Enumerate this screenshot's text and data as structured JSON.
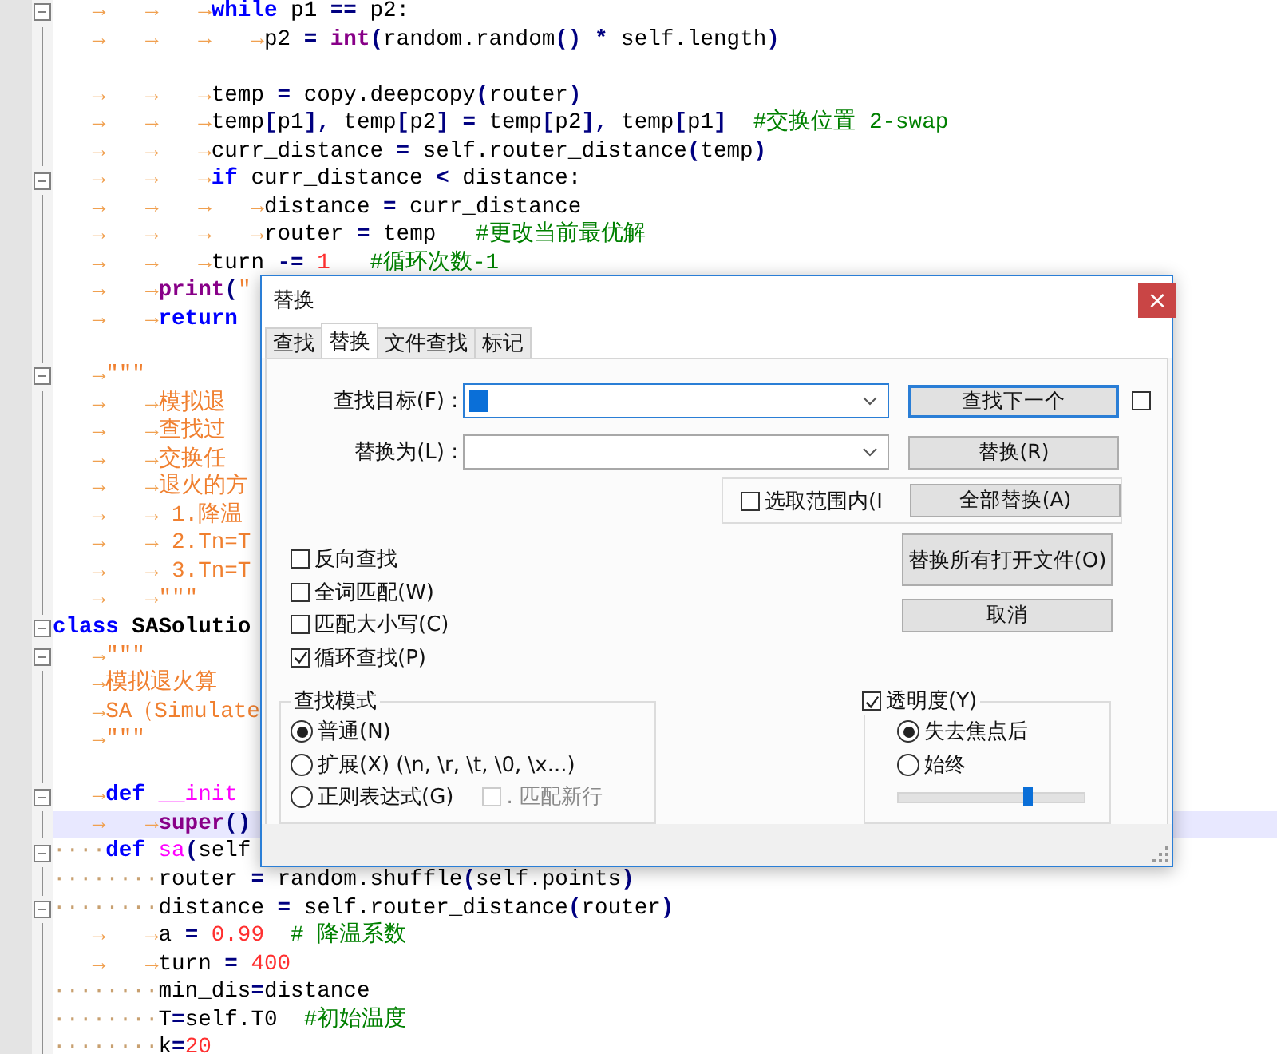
{
  "editor": {
    "lines": [
      {
        "foldable": true,
        "current": false,
        "indent": {
          "kind": "tabs",
          "text": "→→→"
        },
        "tokens": [
          {
            "kind": "kw",
            "text": "while"
          },
          {
            "kind": "txt",
            "text": " p1 "
          },
          {
            "kind": "op",
            "text": "=="
          },
          {
            "kind": "txt",
            "text": " p2:"
          }
        ]
      },
      {
        "foldable": false,
        "current": false,
        "indent": {
          "kind": "tabs",
          "text": "→→→→"
        },
        "tokens": [
          {
            "kind": "txt",
            "text": "p2 "
          },
          {
            "kind": "op",
            "text": "="
          },
          {
            "kind": "bi",
            "text": " int"
          },
          {
            "kind": "op",
            "text": "("
          },
          {
            "kind": "txt",
            "text": "random.random"
          },
          {
            "kind": "op",
            "text": "() *"
          },
          {
            "kind": "txt",
            "text": " self.length"
          },
          {
            "kind": "op",
            "text": ")"
          }
        ]
      },
      {
        "foldable": false,
        "current": false
      },
      {
        "foldable": false,
        "current": false,
        "indent": {
          "kind": "tabs",
          "text": "→→→"
        },
        "tokens": [
          {
            "kind": "txt",
            "text": "temp "
          },
          {
            "kind": "op",
            "text": "="
          },
          {
            "kind": "txt",
            "text": " copy.deepcopy"
          },
          {
            "kind": "op",
            "text": "("
          },
          {
            "kind": "txt",
            "text": "router"
          },
          {
            "kind": "op",
            "text": ")"
          }
        ]
      },
      {
        "foldable": false,
        "current": false,
        "indent": {
          "kind": "tabs",
          "text": "→→→"
        },
        "tokens": [
          {
            "kind": "txt",
            "text": "temp"
          },
          {
            "kind": "op",
            "text": "["
          },
          {
            "kind": "txt",
            "text": "p1"
          },
          {
            "kind": "op",
            "text": "],"
          },
          {
            "kind": "txt",
            "text": " temp"
          },
          {
            "kind": "op",
            "text": "["
          },
          {
            "kind": "txt",
            "text": "p2"
          },
          {
            "kind": "op",
            "text": "] ="
          },
          {
            "kind": "txt",
            "text": " temp"
          },
          {
            "kind": "op",
            "text": "["
          },
          {
            "kind": "txt",
            "text": "p2"
          },
          {
            "kind": "op",
            "text": "],"
          },
          {
            "kind": "txt",
            "text": " temp"
          },
          {
            "kind": "op",
            "text": "["
          },
          {
            "kind": "txt",
            "text": "p1"
          },
          {
            "kind": "op",
            "text": "]"
          },
          {
            "kind": "cmt",
            "text": "  #交换位置 2-swap"
          }
        ]
      },
      {
        "foldable": false,
        "current": false,
        "indent": {
          "kind": "tabs",
          "text": "→→→"
        },
        "tokens": [
          {
            "kind": "txt",
            "text": "curr_distance "
          },
          {
            "kind": "op",
            "text": "="
          },
          {
            "kind": "txt",
            "text": " self.router_distance"
          },
          {
            "kind": "op",
            "text": "("
          },
          {
            "kind": "txt",
            "text": "temp"
          },
          {
            "kind": "op",
            "text": ")"
          }
        ]
      },
      {
        "foldable": true,
        "current": false,
        "indent": {
          "kind": "tabs",
          "text": "→→→"
        },
        "tokens": [
          {
            "kind": "kw",
            "text": "if"
          },
          {
            "kind": "txt",
            "text": " curr_distance "
          },
          {
            "kind": "op",
            "text": "<"
          },
          {
            "kind": "txt",
            "text": " distance:"
          }
        ]
      },
      {
        "foldable": false,
        "current": false,
        "indent": {
          "kind": "tabs",
          "text": "→→→→"
        },
        "tokens": [
          {
            "kind": "txt",
            "text": "distance "
          },
          {
            "kind": "op",
            "text": "="
          },
          {
            "kind": "txt",
            "text": " curr_distance"
          }
        ]
      },
      {
        "foldable": false,
        "current": false,
        "indent": {
          "kind": "tabs",
          "text": "→→→→"
        },
        "tokens": [
          {
            "kind": "txt",
            "text": "router "
          },
          {
            "kind": "op",
            "text": "="
          },
          {
            "kind": "txt",
            "text": " temp"
          },
          {
            "kind": "cmt",
            "text": "   #更改当前最优解"
          }
        ]
      },
      {
        "foldable": false,
        "current": false,
        "indent": {
          "kind": "tabs",
          "text": "→→→"
        },
        "tokens": [
          {
            "kind": "txt",
            "text": "turn "
          },
          {
            "kind": "op",
            "text": "-="
          },
          {
            "kind": "num",
            "text": " 1"
          },
          {
            "kind": "cmt",
            "text": "   #循环次数-1"
          }
        ]
      },
      {
        "foldable": false,
        "current": false,
        "indent": {
          "kind": "tabs",
          "text": "→→"
        },
        "tokens": [
          {
            "kind": "bi",
            "text": "print"
          },
          {
            "kind": "op",
            "text": "("
          },
          {
            "kind": "str",
            "text": "\""
          }
        ]
      },
      {
        "foldable": false,
        "current": false,
        "indent": {
          "kind": "tabs",
          "text": "→→"
        },
        "tokens": [
          {
            "kind": "kw",
            "text": "return"
          }
        ]
      },
      {
        "foldable": false,
        "current": false
      },
      {
        "foldable": true,
        "current": false,
        "indent": {
          "kind": "tabs",
          "text": "→"
        },
        "tokens": [
          {
            "kind": "str",
            "text": "\"\"\""
          }
        ]
      },
      {
        "foldable": false,
        "current": false,
        "indent": {
          "kind": "tabs",
          "text": "→→"
        },
        "tokens": [
          {
            "kind": "str",
            "text": "模拟退"
          }
        ]
      },
      {
        "foldable": false,
        "current": false,
        "indent": {
          "kind": "tabs",
          "text": "→→"
        },
        "tokens": [
          {
            "kind": "str",
            "text": "查找过"
          }
        ]
      },
      {
        "foldable": false,
        "current": false,
        "indent": {
          "kind": "tabs",
          "text": "→→"
        },
        "tokens": [
          {
            "kind": "str",
            "text": "交换任"
          }
        ]
      },
      {
        "foldable": false,
        "current": false,
        "indent": {
          "kind": "tabs",
          "text": "→→"
        },
        "tokens": [
          {
            "kind": "str",
            "text": "退火的方"
          }
        ]
      },
      {
        "foldable": false,
        "current": false,
        "indent": {
          "kind": "tabs",
          "text": "→→"
        },
        "tokens": [
          {
            "kind": "str",
            "text": " 1.降温"
          }
        ]
      },
      {
        "foldable": false,
        "current": false,
        "indent": {
          "kind": "tabs",
          "text": "→→"
        },
        "tokens": [
          {
            "kind": "str",
            "text": " 2.Tn=T"
          }
        ]
      },
      {
        "foldable": false,
        "current": false,
        "indent": {
          "kind": "tabs",
          "text": "→→"
        },
        "tokens": [
          {
            "kind": "str",
            "text": " 3.Tn=T"
          }
        ]
      },
      {
        "foldable": false,
        "current": false,
        "indent": {
          "kind": "tabs",
          "text": "→→"
        },
        "tokens": [
          {
            "kind": "str",
            "text": "\"\"\""
          }
        ]
      },
      {
        "foldable": true,
        "current": false,
        "tokens": [
          {
            "kind": "kw",
            "text": "class"
          },
          {
            "kind": "cls",
            "text": " SASolutio"
          }
        ]
      },
      {
        "foldable": true,
        "current": false,
        "indent": {
          "kind": "tabs",
          "text": "→"
        },
        "tokens": [
          {
            "kind": "str",
            "text": "\"\"\""
          }
        ]
      },
      {
        "foldable": false,
        "current": false,
        "indent": {
          "kind": "tabs",
          "text": "→"
        },
        "tokens": [
          {
            "kind": "str",
            "text": "模拟退火算"
          }
        ]
      },
      {
        "foldable": false,
        "current": false,
        "indent": {
          "kind": "tabs",
          "text": "→"
        },
        "tokens": [
          {
            "kind": "str",
            "text": "SA（Simulate"
          }
        ]
      },
      {
        "foldable": false,
        "current": false,
        "indent": {
          "kind": "tabs",
          "text": "→"
        },
        "tokens": [
          {
            "kind": "str",
            "text": "\"\"\""
          }
        ]
      },
      {
        "foldable": false,
        "current": false
      },
      {
        "foldable": true,
        "current": false,
        "indent": {
          "kind": "tabs",
          "text": "→"
        },
        "tokens": [
          {
            "kind": "kw",
            "text": "def"
          },
          {
            "kind": "fn",
            "text": " __init"
          }
        ]
      },
      {
        "foldable": false,
        "current": true,
        "indent": {
          "kind": "tabs",
          "text": "→→"
        },
        "tokens": [
          {
            "kind": "bi",
            "text": "super"
          },
          {
            "kind": "op",
            "text": "()"
          }
        ]
      },
      {
        "foldable": true,
        "current": false,
        "indent": {
          "kind": "spaces",
          "text": "····"
        },
        "tokens": [
          {
            "kind": "kw",
            "text": "def"
          },
          {
            "kind": "fn",
            "text": " sa"
          },
          {
            "kind": "op",
            "text": "("
          },
          {
            "kind": "txt",
            "text": "self"
          }
        ]
      },
      {
        "foldable": false,
        "current": false,
        "indent": {
          "kind": "spaces",
          "text": "········"
        },
        "tokens": [
          {
            "kind": "txt",
            "text": "router "
          },
          {
            "kind": "op",
            "text": "="
          },
          {
            "kind": "txt",
            "text": " random.shuffle"
          },
          {
            "kind": "op",
            "text": "("
          },
          {
            "kind": "txt",
            "text": "self.points"
          },
          {
            "kind": "op",
            "text": ")"
          }
        ]
      },
      {
        "foldable": true,
        "current": false,
        "indent": {
          "kind": "spaces",
          "text": "········"
        },
        "tokens": [
          {
            "kind": "txt",
            "text": "distance "
          },
          {
            "kind": "op",
            "text": "="
          },
          {
            "kind": "txt",
            "text": " self.router_distance"
          },
          {
            "kind": "op",
            "text": "("
          },
          {
            "kind": "txt",
            "text": "router"
          },
          {
            "kind": "op",
            "text": ")"
          }
        ]
      },
      {
        "foldable": false,
        "current": false,
        "indent": {
          "kind": "tabs",
          "text": "→→"
        },
        "tokens": [
          {
            "kind": "txt",
            "text": "a "
          },
          {
            "kind": "op",
            "text": "="
          },
          {
            "kind": "num",
            "text": " 0.99"
          },
          {
            "kind": "cmt",
            "text": "  # 降温系数"
          }
        ]
      },
      {
        "foldable": false,
        "current": false,
        "indent": {
          "kind": "tabs",
          "text": "→→"
        },
        "tokens": [
          {
            "kind": "txt",
            "text": "turn "
          },
          {
            "kind": "op",
            "text": "="
          },
          {
            "kind": "num",
            "text": " 400"
          }
        ]
      },
      {
        "foldable": false,
        "current": false,
        "indent": {
          "kind": "spaces",
          "text": "········"
        },
        "tokens": [
          {
            "kind": "txt",
            "text": "min_dis"
          },
          {
            "kind": "op",
            "text": "="
          },
          {
            "kind": "txt",
            "text": "distance"
          }
        ]
      },
      {
        "foldable": false,
        "current": false,
        "indent": {
          "kind": "spaces",
          "text": "········"
        },
        "tokens": [
          {
            "kind": "txt",
            "text": "T"
          },
          {
            "kind": "op",
            "text": "="
          },
          {
            "kind": "txt",
            "text": "self.T0"
          },
          {
            "kind": "cmt",
            "text": "  #初始温度"
          }
        ]
      },
      {
        "foldable": false,
        "current": false,
        "indent": {
          "kind": "spaces",
          "text": "········"
        },
        "tokens": [
          {
            "kind": "txt",
            "text": "k"
          },
          {
            "kind": "op",
            "text": "="
          },
          {
            "kind": "num",
            "text": "20"
          }
        ]
      }
    ]
  },
  "dialog": {
    "title": "替换",
    "close": "×",
    "tabs": [
      {
        "label": "查找",
        "selected": false
      },
      {
        "label": "替换",
        "selected": true
      },
      {
        "label": "文件查找",
        "selected": false
      },
      {
        "label": "标记",
        "selected": false
      }
    ],
    "find": {
      "label": "查找目标(F) :",
      "has_selection": true
    },
    "replace": {
      "label": "替换为(L) :"
    },
    "find_next": {
      "label": "查找下一个",
      "extra_checked": false
    },
    "replace_button": "替换(R)",
    "in_selection": {
      "label": "选取范围内(I",
      "checked": false
    },
    "replace_all": "全部替换(A)",
    "replace_all_open": "替换所有打开文件(O)",
    "cancel": "取消",
    "options": [
      {
        "label": "反向查找",
        "checked": false
      },
      {
        "label": "全词匹配(W)",
        "checked": false
      },
      {
        "label": "匹配大小写(C)",
        "checked": false
      },
      {
        "label": "循环查找(P)",
        "checked": true
      }
    ],
    "mode": {
      "title": "查找模式",
      "items": [
        {
          "label": "普通(N)",
          "selected": true
        },
        {
          "label": "扩展(X) (\\n, \\r, \\t, \\0, \\x...)",
          "selected": false
        },
        {
          "label": "正则表达式(G)",
          "selected": false
        }
      ],
      "newline": {
        "label": ". 匹配新行",
        "checked": false,
        "disabled": true
      }
    },
    "transparency": {
      "label": "透明度(Y)",
      "checked": true,
      "items": [
        {
          "label": "失去焦点后",
          "selected": true
        },
        {
          "label": "始终",
          "selected": false
        }
      ],
      "level": 0.7
    }
  }
}
